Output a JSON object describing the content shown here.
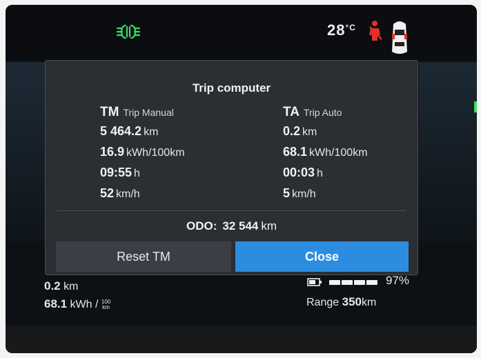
{
  "status": {
    "temperature_value": "28",
    "temperature_unit": "°C",
    "icons": [
      "headlight-icon",
      "seatbelt-warning-icon",
      "car-icon",
      "battery-icon"
    ],
    "colors": {
      "headlight": "#35e060",
      "seatbelt": "#e0322a",
      "accent": "#2c8de0"
    }
  },
  "dialog": {
    "title": "Trip computer",
    "left": {
      "abbr": "TM",
      "name": "Trip Manual",
      "distance": {
        "value": "5 464.2",
        "unit": "km"
      },
      "consumption": {
        "value": "16.9",
        "unit": "kWh/100km"
      },
      "time": {
        "value": "09:55",
        "unit": "h"
      },
      "speed": {
        "value": "52",
        "unit": "km/h"
      }
    },
    "right": {
      "abbr": "TA",
      "name": "Trip Auto",
      "distance": {
        "value": "0.2",
        "unit": "km"
      },
      "consumption": {
        "value": "68.1",
        "unit": "kWh/100km"
      },
      "time": {
        "value": "00:03",
        "unit": "h"
      },
      "speed": {
        "value": "5",
        "unit": "km/h"
      }
    },
    "odo": {
      "label": "ODO:",
      "value": "32 544",
      "unit": "km"
    },
    "buttons": {
      "reset_label": "Reset TM",
      "close_label": "Close"
    }
  },
  "bottom": {
    "trip_distance": {
      "value": "0.2",
      "unit": "km"
    },
    "trip_consumption": {
      "value": "68.1",
      "unit": "kWh /",
      "unit_fraction_top": "100",
      "unit_fraction_bottom": "km"
    },
    "battery_percent": "97%",
    "battery_level": 0.97,
    "range": {
      "label": "Range",
      "value": "350",
      "unit": "km"
    }
  }
}
